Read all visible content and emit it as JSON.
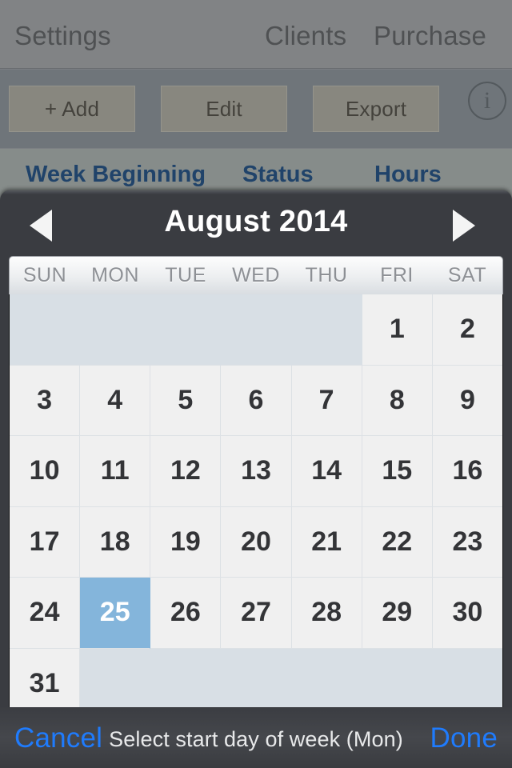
{
  "app": {
    "nav": {
      "settings_label": "Settings",
      "clients_label": "Clients",
      "purchase_label": "Purchase"
    },
    "toolbar": {
      "add_label": "+ Add",
      "edit_label": "Edit",
      "export_label": "Export",
      "info_icon_glyph": "i",
      "info_icon_name": "info-circle-icon"
    },
    "list_header": {
      "week_beginning": "Week Beginning",
      "status": "Status",
      "hours": "Hours"
    }
  },
  "picker": {
    "month_title": "August 2014",
    "prev_arrow_glyph": "",
    "next_arrow_glyph": "",
    "weekdays": [
      "SUN",
      "MON",
      "TUE",
      "WED",
      "THU",
      "FRI",
      "SAT"
    ],
    "weeks": [
      [
        "",
        "",
        "",
        "",
        "",
        "1",
        "2"
      ],
      [
        "3",
        "4",
        "5",
        "6",
        "7",
        "8",
        "9"
      ],
      [
        "10",
        "11",
        "12",
        "13",
        "14",
        "15",
        "16"
      ],
      [
        "17",
        "18",
        "19",
        "20",
        "21",
        "22",
        "23"
      ],
      [
        "24",
        "25",
        "26",
        "27",
        "28",
        "29",
        "30"
      ],
      [
        "31",
        "",
        "",
        "",
        "",
        "",
        ""
      ]
    ],
    "selected_day": "25",
    "selected_position": {
      "week": 4,
      "day": 1
    },
    "footer": {
      "cancel_label": "Cancel",
      "title": "Select start day of week (Mon)",
      "done_label": "Done"
    },
    "colors": {
      "selected_cell_bg": "#84b5db",
      "blank_cell_bg": "#d8dfe5",
      "cell_bg": "#f0f0f0",
      "modal_bg": "#3a3c41",
      "action_blue": "#1f7bfc",
      "header_blue": "#1f4978"
    }
  }
}
